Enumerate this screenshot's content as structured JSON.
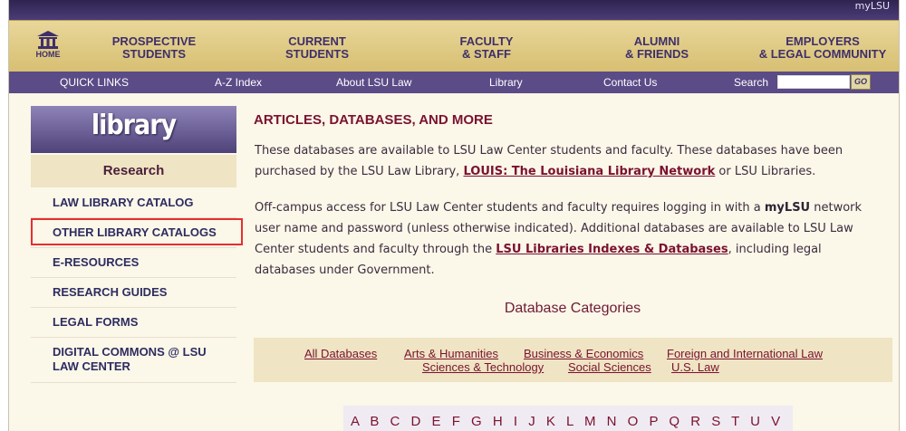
{
  "top": {
    "mylsu": "myLSU"
  },
  "nav": {
    "home": "HOME",
    "items": [
      {
        "l1": "PROSPECTIVE",
        "l2": "STUDENTS"
      },
      {
        "l1": "CURRENT",
        "l2": "STUDENTS"
      },
      {
        "l1": "FACULTY",
        "l2": "& STAFF"
      },
      {
        "l1": "ALUMNI",
        "l2": "& FRIENDS"
      },
      {
        "l1": "EMPLOYERS",
        "l2": "& LEGAL COMMUNITY"
      }
    ]
  },
  "quick": {
    "items": [
      "QUICK LINKS",
      "A-Z Index",
      "About LSU Law",
      "Library",
      "Contact Us"
    ],
    "search_label": "Search",
    "search_value": "",
    "go": "GO"
  },
  "sidebar": {
    "header": "library",
    "section": "Research",
    "items": [
      "LAW LIBRARY CATALOG",
      "OTHER LIBRARY CATALOGS",
      "E-RESOURCES",
      "RESEARCH GUIDES",
      "LEGAL FORMS",
      "DIGITAL COMMONS @ LSU",
      "LAW CENTER"
    ]
  },
  "main": {
    "title": "ARTICLES, DATABASES, AND MORE",
    "p1": {
      "text1": "These databases are available to LSU Law Center students and faculty. These databases have been purchased by the LSU Law Library, ",
      "link": "LOUIS: The Louisiana Library Network",
      "text2": " or LSU Libraries."
    },
    "p2": {
      "text1": "Off-campus access for LSU Law Center students and faculty requires logging in with a ",
      "bold": "myLSU",
      "text2": " network user name and password (unless otherwise indicated).  Additional databases are available to LSU Law Center students and faculty through the ",
      "link": "LSU Libraries Indexes & Databases",
      "text3": ", including legal databases under Government."
    },
    "db_categories_title": "Database Categories",
    "categories": [
      "All Databases",
      "Arts & Humanities",
      "Business & Economics",
      "Foreign and International Law",
      "Sciences & Technology",
      "Social Sciences",
      "U.S. Law"
    ],
    "alphabet": "A B C D E F G H I J K L M N O P Q R S T U V W"
  }
}
